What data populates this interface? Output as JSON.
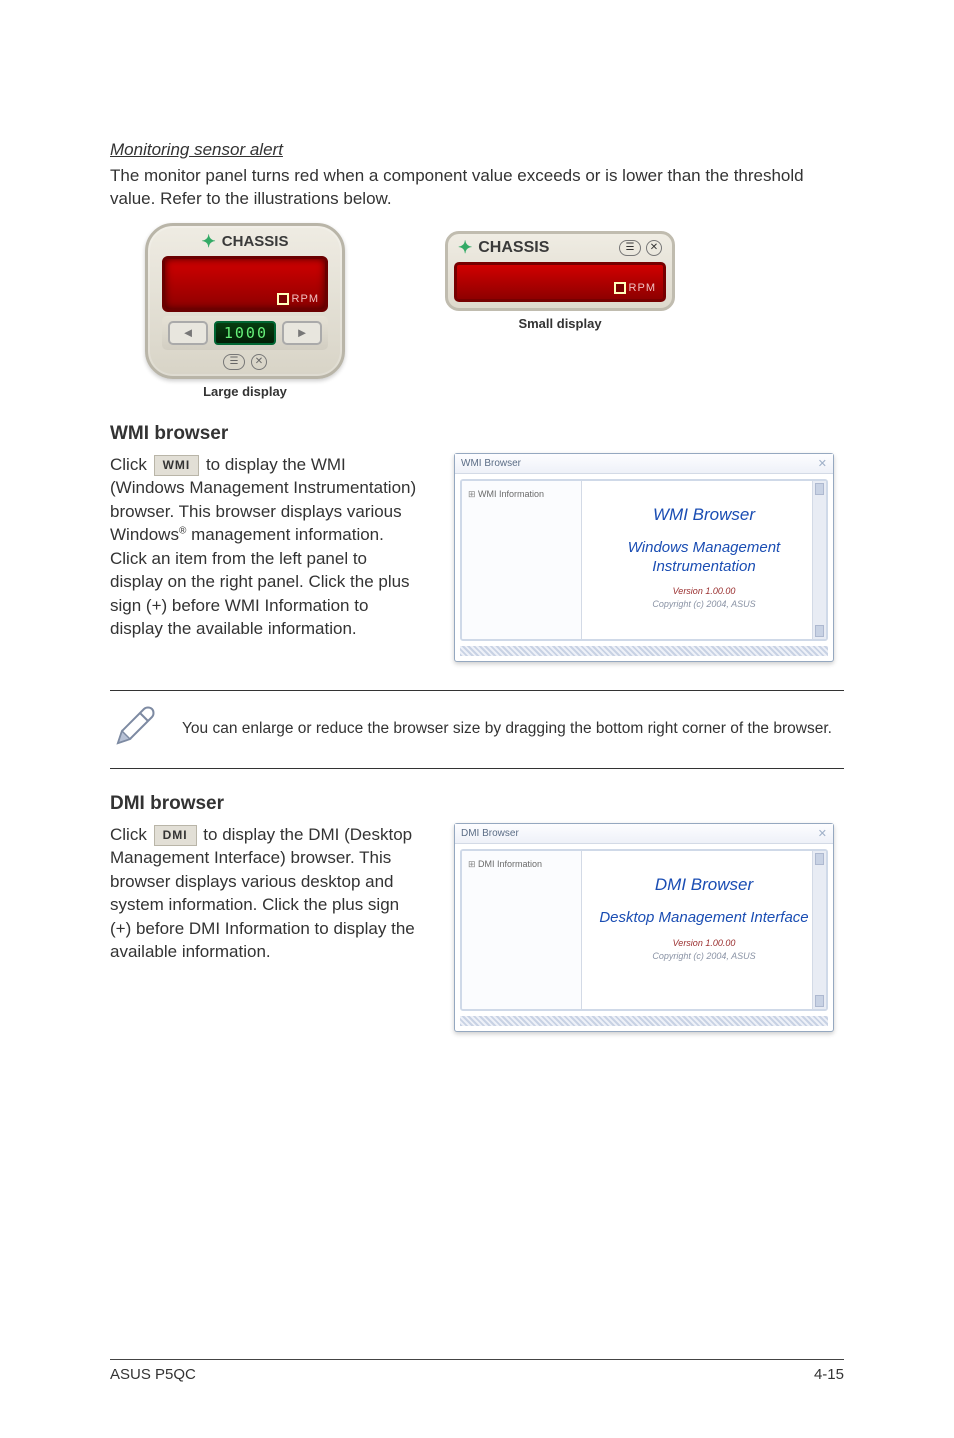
{
  "sensor": {
    "heading": "Monitoring sensor alert",
    "body": "The monitor panel turns red when a component value exceeds or is lower than the threshold value. Refer to the illustrations below.",
    "chassis_label": "CHASSIS",
    "rpm_label": "RPM",
    "green_value": "1000",
    "large_caption": "Large display",
    "small_caption": "Small display"
  },
  "wmi": {
    "heading": "WMI browser",
    "chip": "WMI",
    "p1a": "Click ",
    "p1b": " to display the WMI (Windows Management Instrumentation) browser. This browser displays various Windows",
    "p1c": " management information. Click an item from the left panel to display on the right panel. Click the plus sign (+) before WMI Information to display the available information.",
    "window_title": "WMI Browser",
    "tree_item": "WMI Information",
    "content_title": "WMI  Browser",
    "content_sub": "Windows Management Instrumentation",
    "version": "Version 1.00.00",
    "copyright": "Copyright (c) 2004,  ASUS"
  },
  "note": {
    "text": "You can enlarge or reduce the browser size by dragging the bottom right corner of the browser."
  },
  "dmi": {
    "heading": "DMI browser",
    "chip": "DMI",
    "p1a": "Click ",
    "p1b": " to display the DMI (Desktop Management Interface) browser. This browser displays various desktop and system information. Click the plus sign (+) before DMI Information to display the available information.",
    "window_title": "DMI Browser",
    "tree_item": "DMI Information",
    "content_title": "DMI  Browser",
    "content_sub": "Desktop Management Interface",
    "version": "Version 1.00.00",
    "copyright": "Copyright (c) 2004,  ASUS"
  },
  "footer": {
    "left": "ASUS P5QC",
    "right": "4-15"
  }
}
